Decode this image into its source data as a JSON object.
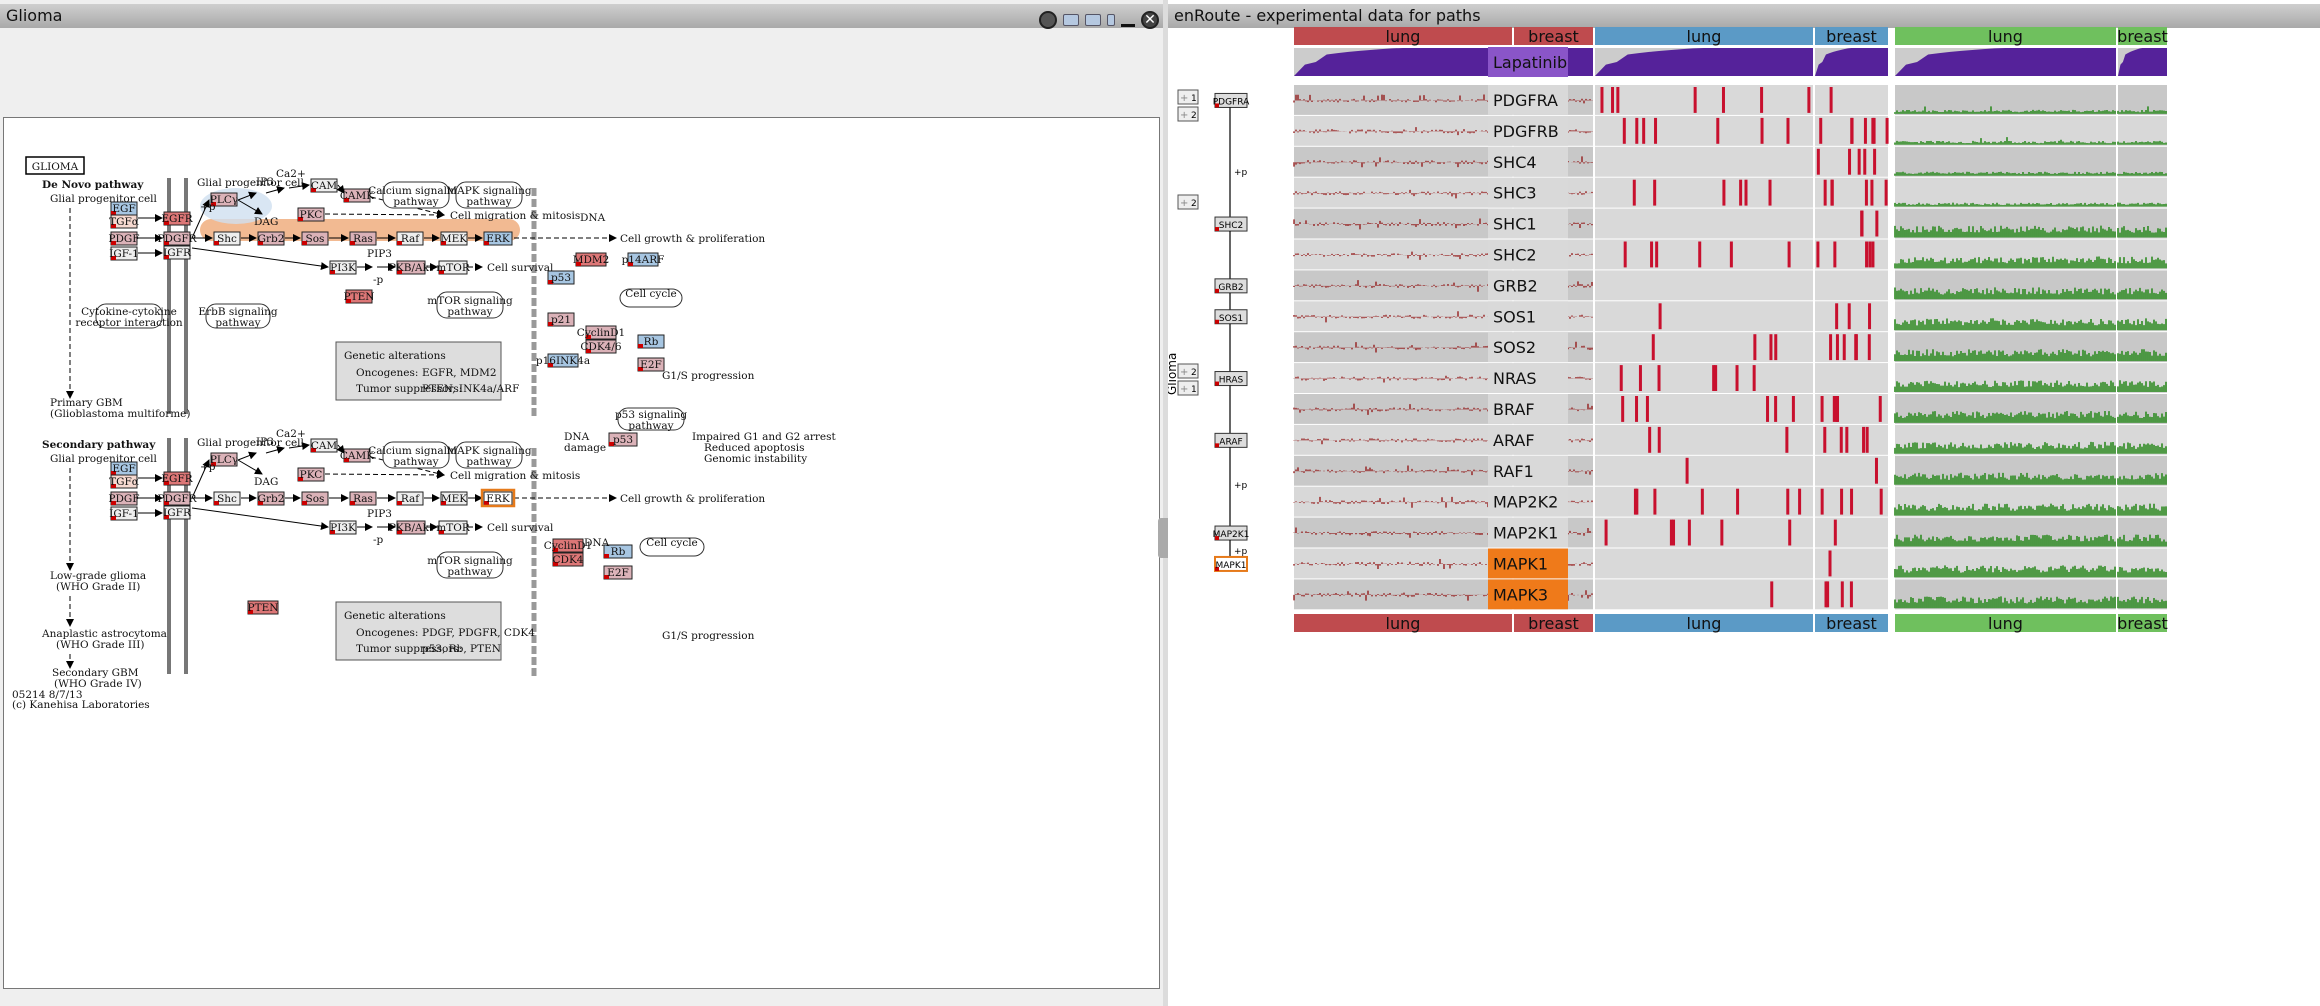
{
  "left_window": {
    "title": "Glioma"
  },
  "right_window": {
    "title": "enRoute - experimental data for paths",
    "side_label": "Glioma"
  },
  "kegg": {
    "title_box": "GLIOMA",
    "denovo": "De Novo pathway",
    "glial1": "Glial progenitor cell",
    "glial_prog": "Glial progenitor cell",
    "primary_gbm": "Primary GBM",
    "primary_gbm2": "(Glioblastoma multiforme)",
    "secondary": "Secondary pathway",
    "glial2": "Glial progenitor cell",
    "lowgrade": "Low-grade glioma",
    "lowgrade2": "(WHO Grade II)",
    "anaplastic": "Anaplastic astrocytoma",
    "anaplastic2": "(WHO Grade III)",
    "secgbm": "Secondary GBM",
    "secgbm2": "(WHO Grade IV)",
    "footer1": "05214 8/7/13",
    "footer2": "(c) Kanehisa Laboratories",
    "calcium": "Calcium signaling",
    "calcium2": "pathway",
    "mapk": "MAPK signaling",
    "mapk2": "pathway",
    "erbb": "ErbB signaling",
    "erbb2": "pathway",
    "cytokine": "Cytokine-cytokine",
    "cytokine2": "receptor interaction",
    "mtor": "mTOR signaling",
    "mtor2": "pathway",
    "cellcycle": "Cell cycle",
    "p53sig": "p53 signaling",
    "p53sig2": "pathway",
    "migration": "Cell migration & mitosis",
    "growth": "Cell growth & proliferation",
    "survival": "Cell survival",
    "g1s": "G1/S progression",
    "dna": "DNA",
    "dna_damage": "DNA",
    "dna_damage2": "damage",
    "impaired1": "Impaired G1 and G2 arrest",
    "impaired2": "Reduced apoptosis",
    "impaired3": "Genomic instability",
    "gen_alt": "Genetic alterations",
    "onc_label": "Oncogenes:",
    "ts_label": "Tumor suppressors:",
    "onc1": "EGFR, MDM2",
    "ts1": "PTEN, INK4a/ARF",
    "onc2": "PDGF, PDGFR, CDK4",
    "ts2": "p53, Rb, PTEN",
    "ip3": "IP3",
    "ca": "Ca2+",
    "dag": "DAG",
    "pip3": "PIP3",
    "plus_p": "+p",
    "minus_p": "-p",
    "genes_top": [
      "EGF",
      "TGFα",
      "PDGF",
      "IGF-1",
      "EGFR",
      "PDGFR",
      "IGFR",
      "PLCγ",
      "PKC",
      "CAM",
      "CAMK",
      "Shc",
      "Grb2",
      "Sos",
      "Ras",
      "Raf",
      "MEK",
      "ERK",
      "PI3K",
      "PKB/Akt",
      "mTOR",
      "PTEN",
      "MDM2",
      "p14ARF",
      "p53",
      "p21",
      "CyclinD1",
      "CDK4/6",
      "p16INK4a",
      "Rb",
      "E2F"
    ],
    "genes_bottom": [
      "EGF",
      "TGFα",
      "PDGF",
      "IGF-1",
      "EGFR",
      "PDGFR",
      "IGFR",
      "PLCγ",
      "PKC",
      "CAM",
      "CAMK",
      "Shc",
      "Grb2",
      "Sos",
      "Ras",
      "Raf",
      "MEK",
      "ERK",
      "PI3K",
      "PKB/Akt",
      "mTOR",
      "PTEN",
      "p53",
      "CyclinD1",
      "CDK4",
      "Rb",
      "E2F"
    ]
  },
  "enroute": {
    "groups": [
      {
        "label": "lung",
        "color": "#bf4b4e"
      },
      {
        "label": "breast",
        "color": "#bf4b4e"
      },
      {
        "label": "lung",
        "color": "#5b9ac6"
      },
      {
        "label": "breast",
        "color": "#5b9ac6"
      },
      {
        "label": "lung",
        "color": "#6fc05e"
      },
      {
        "label": "breast",
        "color": "#6fc05e"
      }
    ],
    "drug": "Lapatinib",
    "drug_color": "#8a55c8",
    "rows": [
      "PDGFRA",
      "PDGFRB",
      "SHC4",
      "SHC3",
      "SHC1",
      "SHC2",
      "GRB2",
      "SOS1",
      "SOS2",
      "NRAS",
      "BRAF",
      "ARAF",
      "RAF1",
      "MAP2K2",
      "MAP2K1",
      "MAPK1",
      "MAPK3"
    ],
    "highlight_rows": [
      "MAPK1",
      "MAPK3"
    ],
    "highlight_color": "#ef7a1a",
    "path_nodes": [
      "PDGFRA",
      "SHC2",
      "GRB2",
      "SOS1",
      "HRAS",
      "ARAF",
      "MAP2K1",
      "MAPK1"
    ],
    "path_badges": [
      "1",
      "2",
      "2",
      "2",
      "1"
    ],
    "path_plus_p": "+p"
  }
}
